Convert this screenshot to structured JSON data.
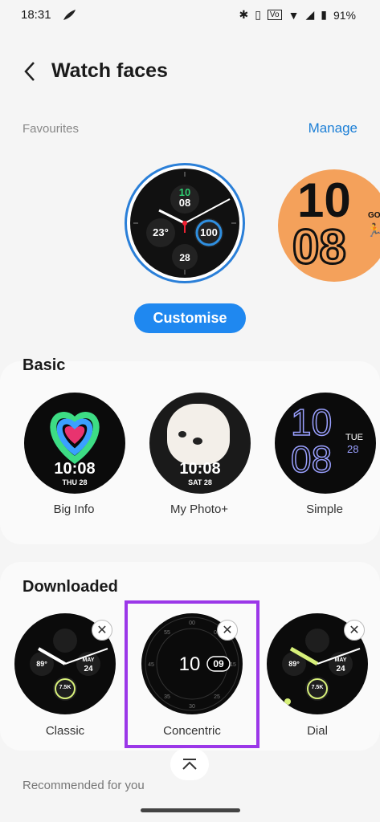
{
  "status_bar": {
    "time": "18:31",
    "battery": "91%"
  },
  "header": {
    "title": "Watch faces",
    "back_icon": "chevron-left-icon"
  },
  "favourites": {
    "label": "Favourites",
    "manage": "Manage",
    "customise": "Customise",
    "main_face": {
      "top": "10",
      "time": "08",
      "temp": "23°",
      "steps": "100",
      "date": "28"
    },
    "second_face": {
      "hour": "10",
      "minute": "08",
      "go": "GO"
    }
  },
  "basic": {
    "title": "Basic",
    "items": [
      {
        "name": "Big Info",
        "time": "10:08",
        "date": "THU 28"
      },
      {
        "name": "My Photo+",
        "time": "10:08",
        "date": "SAT 28"
      },
      {
        "name": "Simple",
        "hour": "10",
        "minute": "08",
        "day": "TUE",
        "date": "28"
      }
    ]
  },
  "downloaded": {
    "title": "Downloaded",
    "items": [
      {
        "name": "Classic",
        "temp": "89°",
        "day": "MAY",
        "date": "24",
        "steps": "7.5K"
      },
      {
        "name": "Concentric",
        "hour": "10",
        "minute": "09"
      },
      {
        "name": "Dial",
        "temp": "89°",
        "day": "MAY",
        "date": "24",
        "steps": "7.5K"
      }
    ]
  },
  "recommended": "Recommended for you",
  "colors": {
    "accent": "#1f88f0",
    "highlight": "#9b37e8"
  }
}
